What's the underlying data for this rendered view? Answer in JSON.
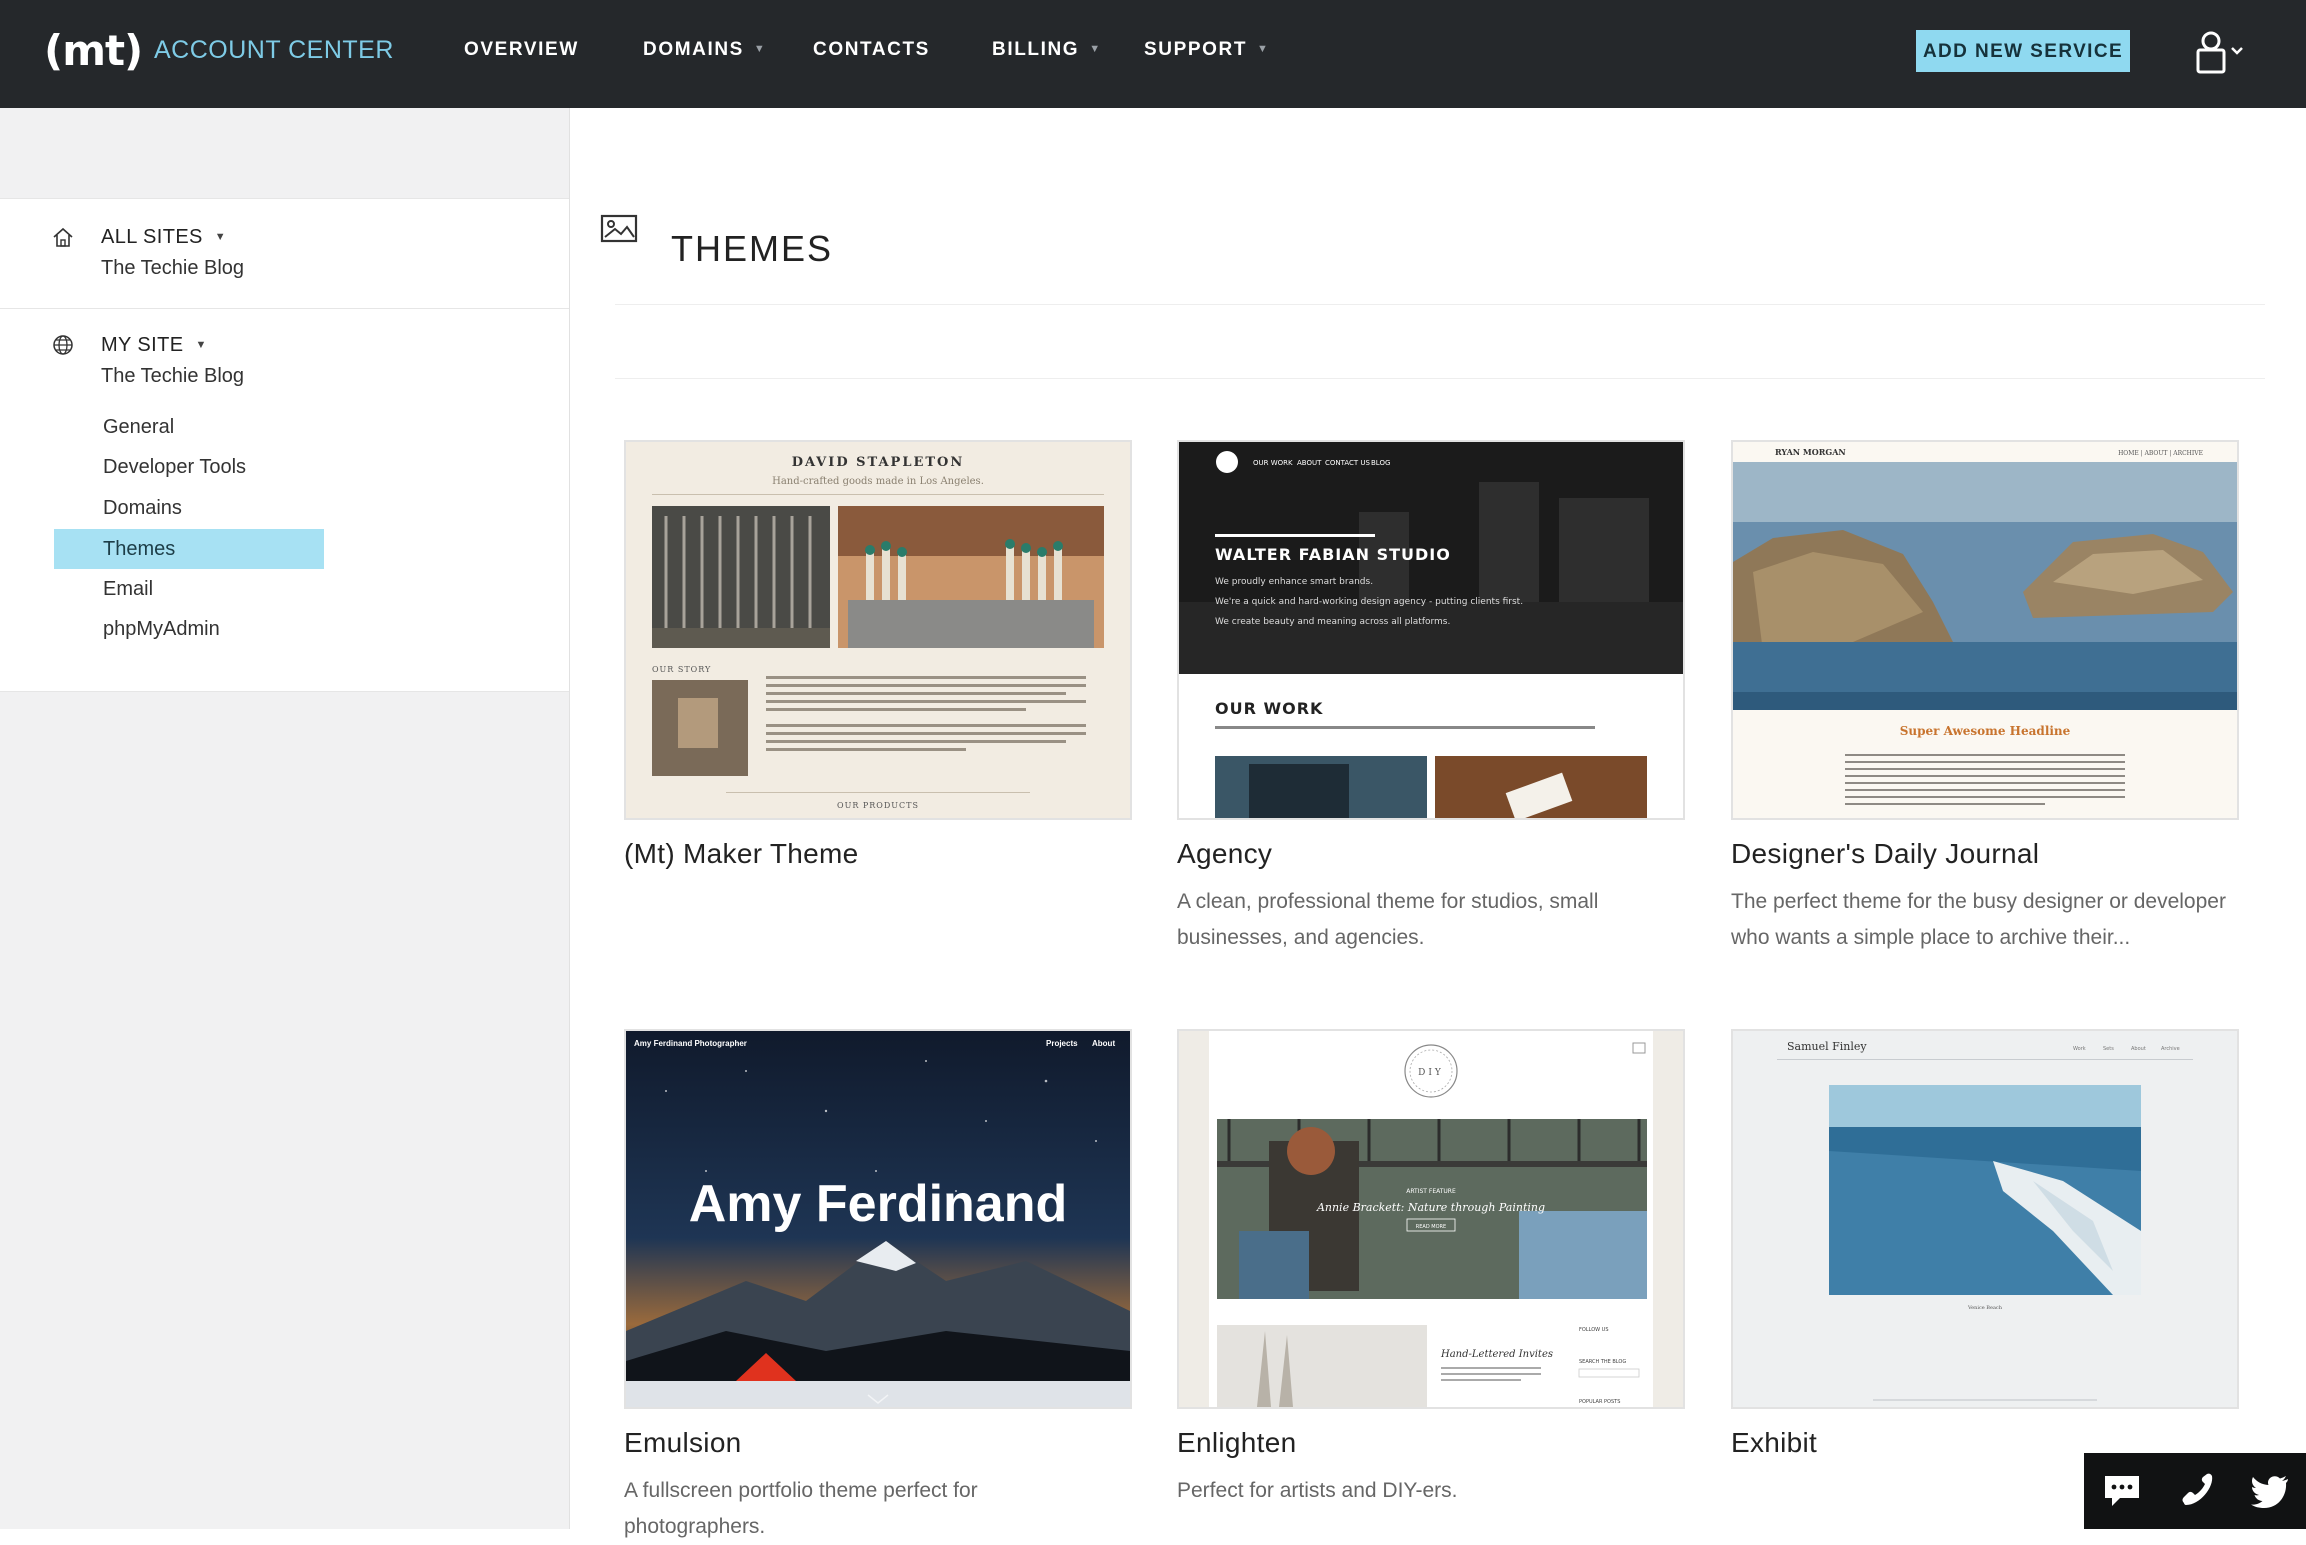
{
  "header": {
    "logo_text": "(mt)",
    "brand_title": "ACCOUNT CENTER",
    "nav": [
      {
        "label": "OVERVIEW",
        "has_dropdown": false
      },
      {
        "label": "DOMAINS",
        "has_dropdown": true
      },
      {
        "label": "CONTACTS",
        "has_dropdown": false
      },
      {
        "label": "BILLING",
        "has_dropdown": true
      },
      {
        "label": "SUPPORT",
        "has_dropdown": true
      }
    ],
    "add_service_label": "ADD NEW SERVICE"
  },
  "sidebar": {
    "all_sites": {
      "title": "ALL SITES",
      "subtitle": "The Techie Blog"
    },
    "my_site": {
      "title": "MY SITE",
      "subtitle": "The Techie Blog"
    },
    "menu": [
      {
        "label": "General",
        "active": false
      },
      {
        "label": "Developer Tools",
        "active": false
      },
      {
        "label": "Domains",
        "active": false
      },
      {
        "label": "Themes",
        "active": true
      },
      {
        "label": "Email",
        "active": false
      },
      {
        "label": "phpMyAdmin",
        "active": false
      }
    ]
  },
  "main": {
    "title": "THEMES",
    "themes": [
      {
        "name": "(Mt) Maker Theme",
        "description": "",
        "preview": {
          "header": "DAVID STAPLETON",
          "tagline": "Hand-crafted goods made in Los Angeles.",
          "section": "OUR STORY",
          "footer": "OUR PRODUCTS"
        }
      },
      {
        "name": "Agency",
        "description": "A clean, professional theme for studios, small businesses, and agencies.",
        "preview": {
          "nav": [
            "OUR WORK",
            "ABOUT",
            "CONTACT US",
            "BLOG"
          ],
          "heading": "WALTER FABIAN STUDIO",
          "lines": [
            "We proudly enhance smart brands.",
            "We're a quick and hard-working design agency - putting clients first.",
            "We create beauty and meaning across all platforms."
          ],
          "section": "OUR WORK"
        }
      },
      {
        "name": "Designer's Daily Journal",
        "description": "The perfect theme for the busy designer or developer who wants a simple place to archive their...",
        "preview": {
          "header": "RYAN MORGAN",
          "nav": "HOME | ABOUT | ARCHIVE",
          "headline": "Super Awesome Headline"
        }
      },
      {
        "name": "Emulsion",
        "description": "A fullscreen portfolio theme perfect for photographers.",
        "preview": {
          "brand": "Amy Ferdinand Photographer",
          "nav": [
            "Projects",
            "About"
          ],
          "hero": "Amy Ferdinand"
        }
      },
      {
        "name": "Enlighten",
        "description": "Perfect for artists and DIY-ers.",
        "preview": {
          "badge": "DIY",
          "feature_label": "ARTIST FEATURE",
          "feature_title": "Annie Brackett: Nature through Painting",
          "read_more": "READ MORE",
          "post_title": "Hand-Lettered Invites",
          "follow": "FOLLOW US",
          "search": "SEARCH THE BLOG",
          "popular": "POPULAR POSTS"
        }
      },
      {
        "name": "Exhibit",
        "description": "",
        "preview": {
          "header": "Samuel Finley",
          "nav": [
            "Work",
            "Sets",
            "About",
            "Archive"
          ],
          "caption": "Venice Beach"
        }
      }
    ]
  },
  "colors": {
    "topbar_bg": "#25282b",
    "accent": "#8fd9f0",
    "active_item_bg": "#a7e1f3",
    "social_bg": "#111213"
  }
}
